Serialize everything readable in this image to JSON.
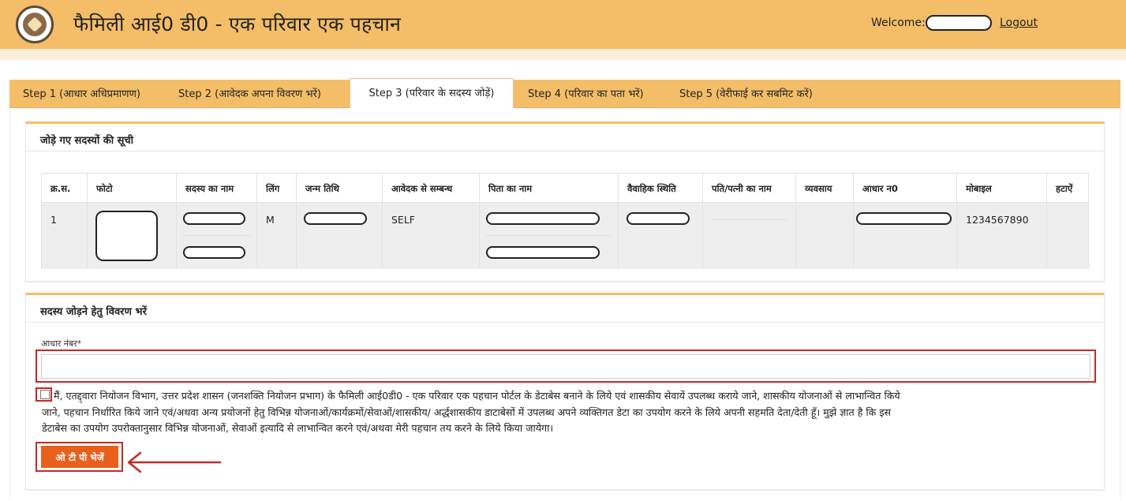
{
  "header": {
    "title": "फैमिली आई0 डी0 - एक परिवार एक पहचान",
    "welcome_label": "Welcome:",
    "logout_label": "Logout",
    "logo_icon": "up-government-emblem-icon",
    "bg_color": "#f4be68"
  },
  "tabs": [
    {
      "label": "Step 1 (आधार अधिप्रमाणण)",
      "active": false
    },
    {
      "label": "Step 2 (आवेदक अपना विवरण भरें)",
      "active": false
    },
    {
      "label": "Step 3 (परिवार के सदस्य जोड़ें)",
      "active": true
    },
    {
      "label": "Step 4 (परिवार का पता भरें)",
      "active": false
    },
    {
      "label": "Step 5 (वेरीफाई कर सबमिट करें)",
      "active": false
    }
  ],
  "members_panel": {
    "title": "जोड़े गए सदस्यों की सूची",
    "columns": [
      "क्र.स.",
      "फोटो",
      "सदस्य का नाम",
      "लिंग",
      "जन्म तिथि",
      "आवेदक से सम्बन्ध",
      "पिता का नाम",
      "वैवाहिक स्थिति",
      "पति/पत्नी का नाम",
      "व्यवसाय",
      "आधार न0",
      "मोबाइल",
      "हटाऐं"
    ],
    "rows": [
      {
        "sno": "1",
        "gender": "M",
        "relation": "SELF",
        "mobile": "1234567890"
      }
    ]
  },
  "add_panel": {
    "title": "सदस्य जोड़ने हेतु विवरण भरें",
    "aadhaar_label": "आधार नंबर*",
    "aadhaar_value": "",
    "consent_lines": [
      "मैं, एतद्द्वारा नियोजन विभाग, उत्तर प्रदेश शासन (जनशक्ति नियोजन प्रभाग) के फैमिली आई0डी0 - एक परिवार एक पहचान पोर्टल के डेटाबेस बनाने के लिये एवं शासकीय सेवायें उपलब्ध कराये जाने, शासकीय योजनाओं से लाभान्वित किये",
      "जाने, पहचान निर्धारित किये जाने एवं/अथवा अन्य प्रयोजनों हेतु विभिन्न योजनाओं/कार्यक्रमों/सेवाओं/शासकीय/ अर्द्धशासकीय डाटाबेसों में उपलब्ध अपने व्यक्तिगत डेटा का उपयोग करने के लिये अपनी सहमति देता/देती हूँ। मुझे ज्ञात है कि इस",
      "डेटाबेस का उपयोग उपरोक्तानुसार विभिन्न योजनाओं, सेवाओं इत्यादि से लाभान्वित करने एवं/अथवा मेरी पहचान तय करने के लिये किया जायेगा।"
    ],
    "otp_button": "ओ टी पी भेजें",
    "otp_button_color": "#e8601c",
    "highlight_color": "#c62828"
  }
}
